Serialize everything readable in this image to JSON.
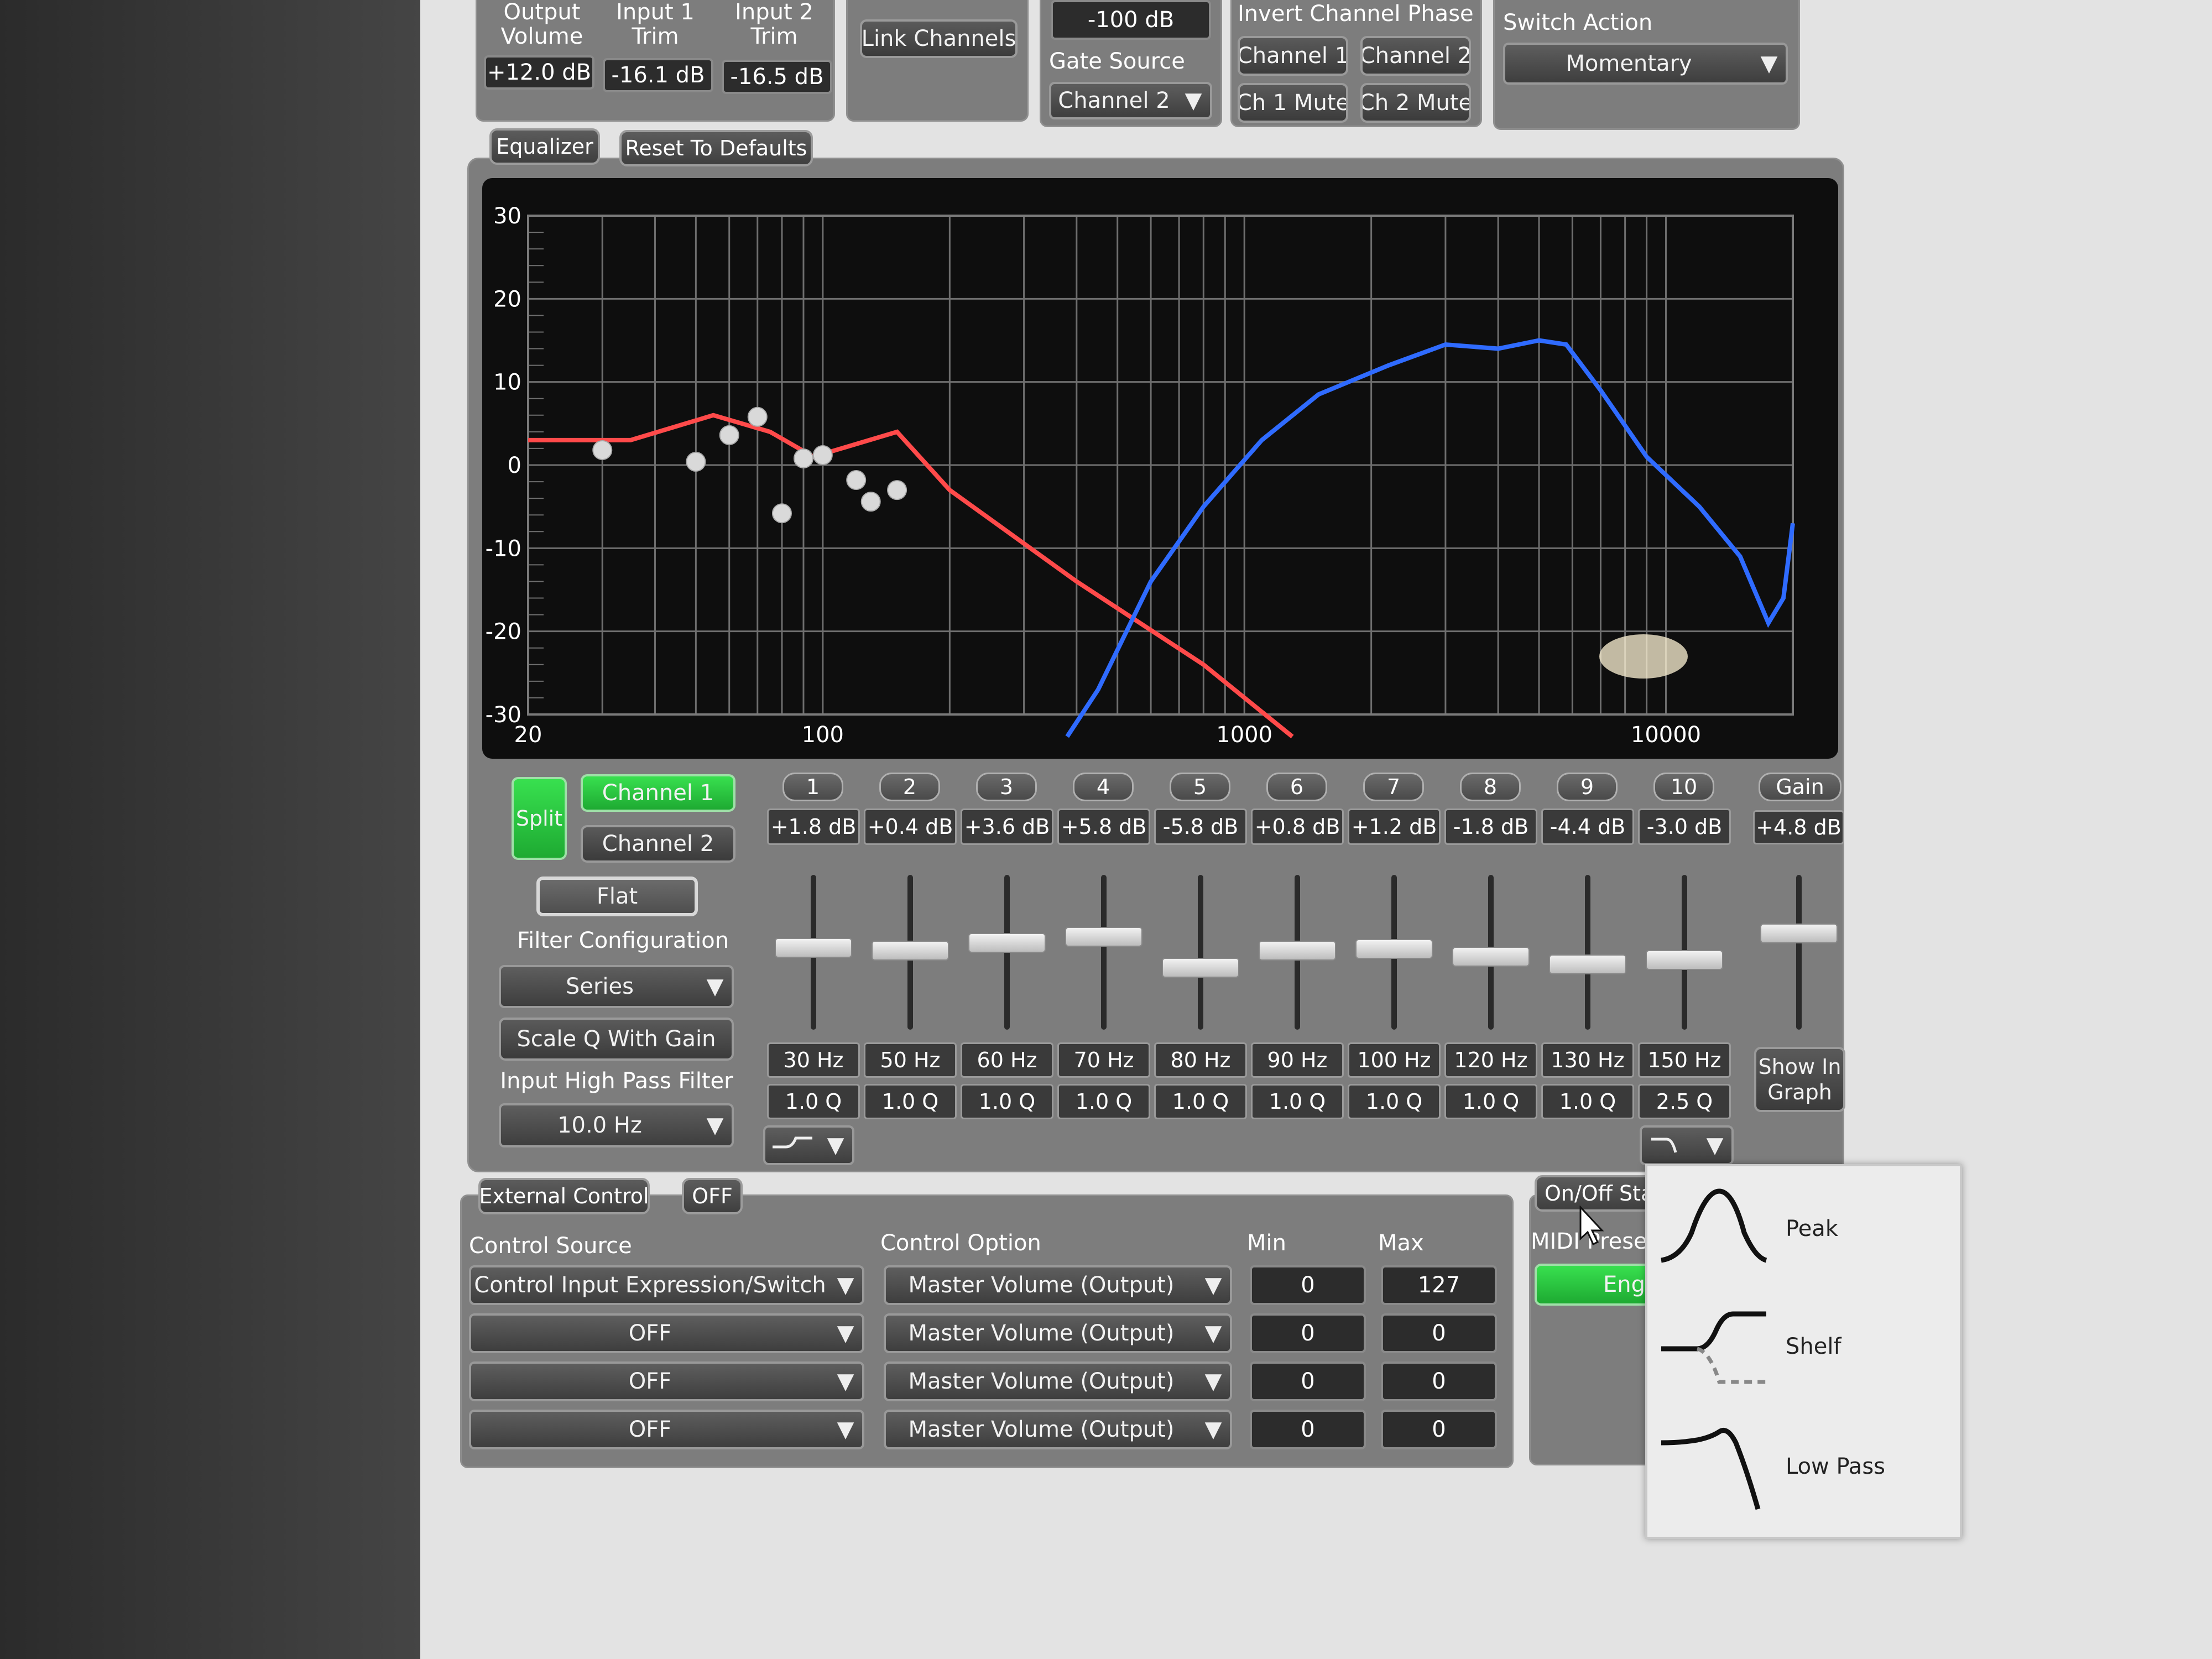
{
  "top": {
    "output_volume": {
      "label": "Output\nVolume",
      "value": "+12.0 dB"
    },
    "input1_trim": {
      "label": "Input 1\nTrim",
      "value": "-16.1 dB"
    },
    "input2_trim": {
      "label": "Input 2\nTrim",
      "value": "-16.5 dB"
    },
    "link_channels": "Link Channels",
    "gate_threshold": "-100 dB",
    "gate_source_label": "Gate Source",
    "gate_source_value": "Channel 2",
    "invert_phase_label": "Invert Channel Phase",
    "phase_ch1": "Channel 1",
    "phase_ch2": "Channel 2",
    "ch1_mute": "Ch 1 Mute",
    "ch2_mute": "Ch 2 Mute",
    "switch_action_label": "Switch Action",
    "switch_action_value": "Momentary"
  },
  "equalizer": {
    "tab": "Equalizer",
    "reset": "Reset To Defaults",
    "graph": {
      "y_ticks": [
        "30",
        "20",
        "10",
        "0",
        "-10",
        "-20",
        "-30"
      ],
      "x_ticks": [
        "20",
        "100",
        "1000",
        "10000"
      ],
      "ylim": [
        -30,
        30
      ],
      "xlim": [
        20,
        20000
      ],
      "red_curve": [
        [
          20,
          3
        ],
        [
          35,
          3
        ],
        [
          55,
          6
        ],
        [
          75,
          4
        ],
        [
          95,
          1
        ],
        [
          150,
          4
        ],
        [
          200,
          -3
        ],
        [
          400,
          -14
        ],
        [
          800,
          -24
        ],
        [
          1300,
          -35
        ]
      ],
      "blue_curve": [
        [
          380,
          -35
        ],
        [
          450,
          -27
        ],
        [
          600,
          -14
        ],
        [
          800,
          -5
        ],
        [
          1100,
          3
        ],
        [
          1500,
          8.5
        ],
        [
          2200,
          12
        ],
        [
          3000,
          14.5
        ],
        [
          4000,
          14
        ],
        [
          5000,
          15
        ],
        [
          5800,
          14.5
        ],
        [
          7000,
          9
        ],
        [
          9000,
          1
        ],
        [
          12000,
          -5
        ],
        [
          15000,
          -11
        ],
        [
          17500,
          -19
        ],
        [
          19000,
          -16
        ],
        [
          20000,
          -7
        ]
      ],
      "points": [
        [
          30,
          1.8
        ],
        [
          50,
          0.4
        ],
        [
          60,
          3.6
        ],
        [
          70,
          5.8
        ],
        [
          80,
          -5.8
        ],
        [
          90,
          0.8
        ],
        [
          100,
          1.2
        ],
        [
          120,
          -1.8
        ],
        [
          130,
          -4.4
        ],
        [
          150,
          -3.0
        ]
      ],
      "colors": {
        "red": "#ff4a4a",
        "blue": "#2f6bff"
      }
    },
    "split": "Split",
    "channel1": "Channel 1",
    "channel2": "Channel 2",
    "flat": "Flat",
    "filter_config_label": "Filter Configuration",
    "filter_config_value": "Series",
    "scale_q": "Scale Q With Gain",
    "hpf_label": "Input High Pass Filter",
    "hpf_value": "10.0 Hz",
    "bands": [
      {
        "num": "1",
        "gain": "+1.8 dB",
        "freq": "30 Hz",
        "q": "1.0 Q",
        "level": 0.53
      },
      {
        "num": "2",
        "gain": "+0.4 dB",
        "freq": "50 Hz",
        "q": "1.0 Q",
        "level": 0.51
      },
      {
        "num": "3",
        "gain": "+3.6 dB",
        "freq": "60 Hz",
        "q": "1.0 Q",
        "level": 0.56
      },
      {
        "num": "4",
        "gain": "+5.8 dB",
        "freq": "70 Hz",
        "q": "1.0 Q",
        "level": 0.6
      },
      {
        "num": "5",
        "gain": "-5.8 dB",
        "freq": "80 Hz",
        "q": "1.0 Q",
        "level": 0.4
      },
      {
        "num": "6",
        "gain": "+0.8 dB",
        "freq": "90 Hz",
        "q": "1.0 Q",
        "level": 0.51
      },
      {
        "num": "7",
        "gain": "+1.2 dB",
        "freq": "100 Hz",
        "q": "1.0 Q",
        "level": 0.52
      },
      {
        "num": "8",
        "gain": "-1.8 dB",
        "freq": "120 Hz",
        "q": "1.0 Q",
        "level": 0.47
      },
      {
        "num": "9",
        "gain": "-4.4 dB",
        "freq": "130 Hz",
        "q": "1.0 Q",
        "level": 0.42
      },
      {
        "num": "10",
        "gain": "-3.0 dB",
        "freq": "150 Hz",
        "q": "2.5 Q",
        "level": 0.45
      }
    ],
    "gain": {
      "label": "Gain",
      "value": "+4.8 dB",
      "level": 0.62
    },
    "show_in_graph": "Show In\nGraph"
  },
  "external_control": {
    "tab": "External Control",
    "state": "OFF",
    "control_source_label": "Control Source",
    "control_option_label": "Control Option",
    "min_label": "Min",
    "max_label": "Max",
    "rows": [
      {
        "source": "Control Input Expression/Switch",
        "option": "Master Volume (Output)",
        "min": "0",
        "max": "127"
      },
      {
        "source": "OFF",
        "option": "Master Volume (Output)",
        "min": "0",
        "max": "0"
      },
      {
        "source": "OFF",
        "option": "Master Volume (Output)",
        "min": "0",
        "max": "0"
      },
      {
        "source": "OFF",
        "option": "Master Volume (Output)",
        "min": "0",
        "max": "0"
      }
    ]
  },
  "onoff": {
    "tab": "On/Off Sta",
    "midi": "MIDI Prese",
    "engage": "Eng"
  },
  "filter_popup": {
    "items": [
      "Peak",
      "Shelf",
      "Low Pass"
    ]
  }
}
